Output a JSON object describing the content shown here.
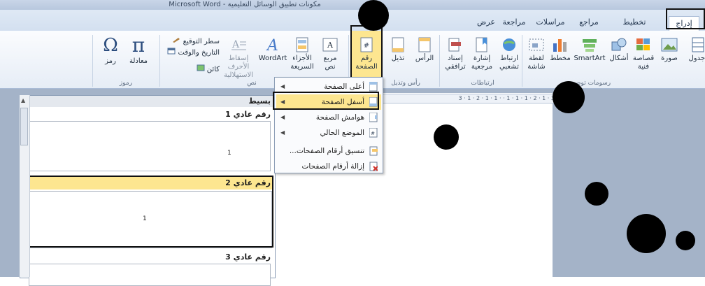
{
  "title_bar": {
    "title": "مكونات تطبيق الوسائل التعليمية - Microsoft Word"
  },
  "tabs": [
    {
      "label": "إدراج",
      "active": true
    },
    {
      "label": "تخطيط الصفحة"
    },
    {
      "label": "مراجع"
    },
    {
      "label": "مراسلات"
    },
    {
      "label": "مراجعة"
    },
    {
      "label": "عرض"
    }
  ],
  "ribbon": {
    "groups": {
      "illustrations": "رسومات توضيحية",
      "links": "ارتباطات",
      "header_footer": "رأس وتذيل",
      "text": "نص",
      "symbols": "رموز"
    },
    "buttons": {
      "tables": "جدول",
      "picture": "صورة",
      "clip_art": "قصاصة",
      "clip_art_2": "فنية",
      "shapes": "أشكال",
      "smartart": "SmartArt",
      "chart": "مخطط",
      "screenshot": "لقطة",
      "screenshot_2": "شاشة",
      "hyperlink": "ارتباط",
      "hyperlink_2": "تشعبي",
      "bookmark": "إشارة",
      "bookmark_2": "مرجعية",
      "cross_ref": "إسناد",
      "cross_ref_2": "ترافقي",
      "header": "الرأس",
      "footer": "تذيل",
      "page_number": "رقم",
      "page_number_2": "الصفحة",
      "text_box": "مربع",
      "text_box_2": "نص",
      "quick_parts": "الأجزاء",
      "quick_parts_2": "السريعة",
      "wordart": "WordArt",
      "drop_cap": "إسقاط الأحرف",
      "drop_cap_2": "الاستهلالية",
      "signature": "سطر التوقيع",
      "date_time": "التاريخ والوقت",
      "object": "كائن",
      "equation": "معادلة",
      "symbol": "رمز"
    }
  },
  "menu": {
    "items": [
      {
        "label": "أعلى الصفحة",
        "submenu": true
      },
      {
        "label": "أسفل الصفحة",
        "submenu": true,
        "highlighted": true
      },
      {
        "label": "هوامش الصفحة",
        "submenu": true
      },
      {
        "label": "الموضع الحالي",
        "submenu": true
      },
      {
        "label": "تنسيق أرقام الصفحات...",
        "submenu": false
      },
      {
        "label": "إزالة أرقام الصفحات",
        "submenu": false
      }
    ]
  },
  "gallery": {
    "header": "بسيط",
    "items": [
      {
        "title": "رقم عادي 1",
        "number": "1"
      },
      {
        "title": "رقم عادي 2",
        "number": "1"
      },
      {
        "title": "رقم عادي 3",
        "number": ""
      }
    ]
  },
  "ruler": {
    "text": "3 · 1 · 2 · 1 · 1 · 1 · · 1 · 1 · 2 · 1 · 3"
  },
  "colors": {
    "highlight": "#fde690",
    "ribbon_border": "#a9bcd6",
    "workspace": "#a4b3c8"
  }
}
